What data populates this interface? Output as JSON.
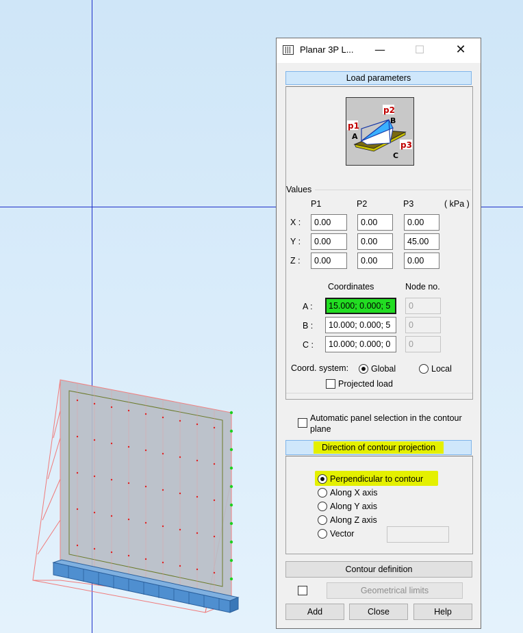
{
  "dialog": {
    "title": "Planar 3P L...",
    "window_controls": {
      "minimize": "—",
      "maximize": "☐",
      "close": "✕"
    },
    "load_parameters_header": "Load parameters",
    "diagram_labels": {
      "p1": "p1",
      "p2": "p2",
      "p3": "p3",
      "a": "A",
      "b": "B",
      "c": "C"
    },
    "values": {
      "label": "Values",
      "unit": "( kPa )",
      "columns": [
        "P1",
        "P2",
        "P3"
      ],
      "rows": [
        {
          "axis": "X :",
          "p1": "0.00",
          "p2": "0.00",
          "p3": "0.00"
        },
        {
          "axis": "Y :",
          "p1": "0.00",
          "p2": "0.00",
          "p3": "45.00"
        },
        {
          "axis": "Z :",
          "p1": "0.00",
          "p2": "0.00",
          "p3": "0.00"
        }
      ]
    },
    "coordinates": {
      "col_coordinates": "Coordinates",
      "col_node": "Node no.",
      "rows": [
        {
          "label": "A :",
          "coord": "15.000; 0.000; 5",
          "node": "0"
        },
        {
          "label": "B :",
          "coord": "10.000; 0.000; 5",
          "node": "0"
        },
        {
          "label": "C :",
          "coord": "10.000; 0.000; 0",
          "node": "0"
        }
      ]
    },
    "coord_system": {
      "label": "Coord. system:",
      "global": "Global",
      "local": "Local",
      "selected": "Global",
      "projected_load": "Projected load"
    },
    "auto_panel_selection": "Automatic panel selection in the contour plane",
    "direction_header": "Direction of contour projection",
    "direction_options": [
      "Perpendicular to contour",
      "Along X axis",
      "Along Y axis",
      "Along Z axis",
      "Vector"
    ],
    "direction_selected": "Perpendicular to contour",
    "contour_definition": "Contour definition",
    "geometrical_limits": "Geometrical limits",
    "buttons": {
      "add": "Add",
      "close": "Close",
      "help": "Help"
    },
    "colors": {
      "highlight": "#e4f000",
      "green_field": "#22dd22",
      "header_bg": "#cfe7fb"
    }
  }
}
